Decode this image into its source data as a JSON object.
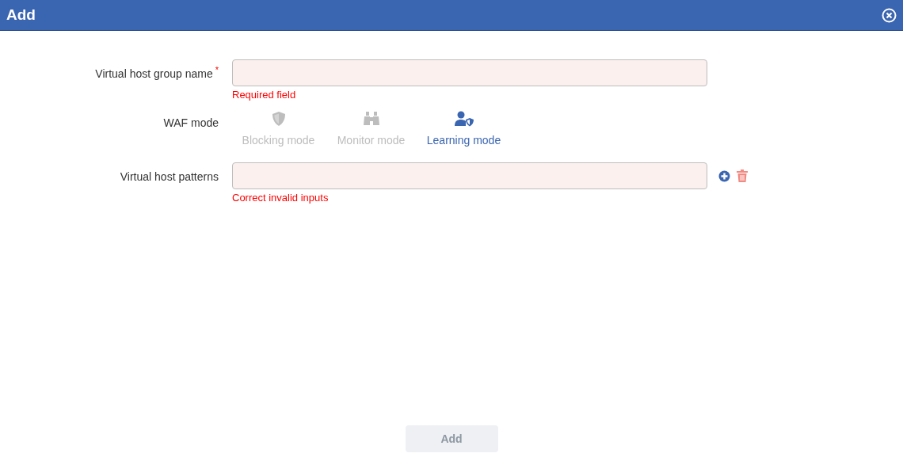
{
  "window": {
    "title": "Add"
  },
  "fields": [
    {
      "kind": "text",
      "label": "Virtual host group name",
      "required_mark": "*",
      "error": "Required field"
    },
    {
      "kind": "modes",
      "label": "WAF mode",
      "modes": [
        {
          "kind": "shield",
          "label": "Blocking mode",
          "selected": false
        },
        {
          "kind": "binoculars",
          "label": "Monitor mode",
          "selected": false
        },
        {
          "kind": "user-shield",
          "label": "Learning mode",
          "selected": true
        }
      ]
    },
    {
      "kind": "text",
      "label": "Virtual host patterns",
      "error": "Correct invalid inputs",
      "actions": [
        {
          "kind": "add"
        },
        {
          "kind": "delete"
        }
      ]
    }
  ],
  "submit": {
    "label": "Add",
    "disabled": true
  }
}
